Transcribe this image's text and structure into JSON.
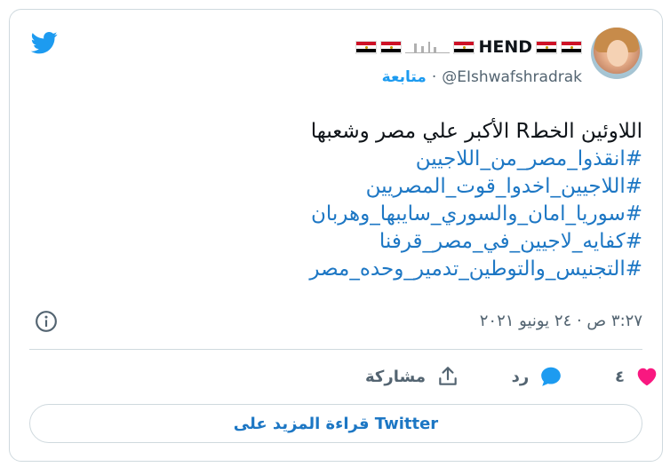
{
  "author": {
    "display_name": "HEND",
    "handle": "@EIshwafshradrak",
    "separator": "·",
    "follow_label": "متابعة"
  },
  "tweet": {
    "lines": [
      "اللاوئين الخطR الأكبر علي مصر وشعبها",
      "#انقذوا_مصر_من_اللاجيين",
      "#اللاجيين_اخدوا_قوت_المصريين",
      "#سوريا_امان_والسوري_سايبها_وهربان",
      "#كفايه_لاجيين_في_مصر_قرفنا",
      "#التجنيس_والتوطين_تدمير_وحده_مصر"
    ]
  },
  "timestamp": "٣:٢٧ ص · ٢٤ يونيو ٢٠٢١",
  "actions": {
    "like_count": "٤",
    "reply_label": "رد",
    "share_label": "مشاركة"
  },
  "read_more_label": "قراءة المزيد على Twitter",
  "colors": {
    "accent": "#1d9bf0",
    "hashtag": "#1d77c4",
    "like": "#f91880",
    "muted": "#536471",
    "border": "#cfd9de"
  },
  "icons": {
    "logo": "twitter-bird-icon",
    "info": "info-icon",
    "like": "heart-icon",
    "reply": "speech-bubble-icon",
    "share": "share-upload-icon"
  }
}
